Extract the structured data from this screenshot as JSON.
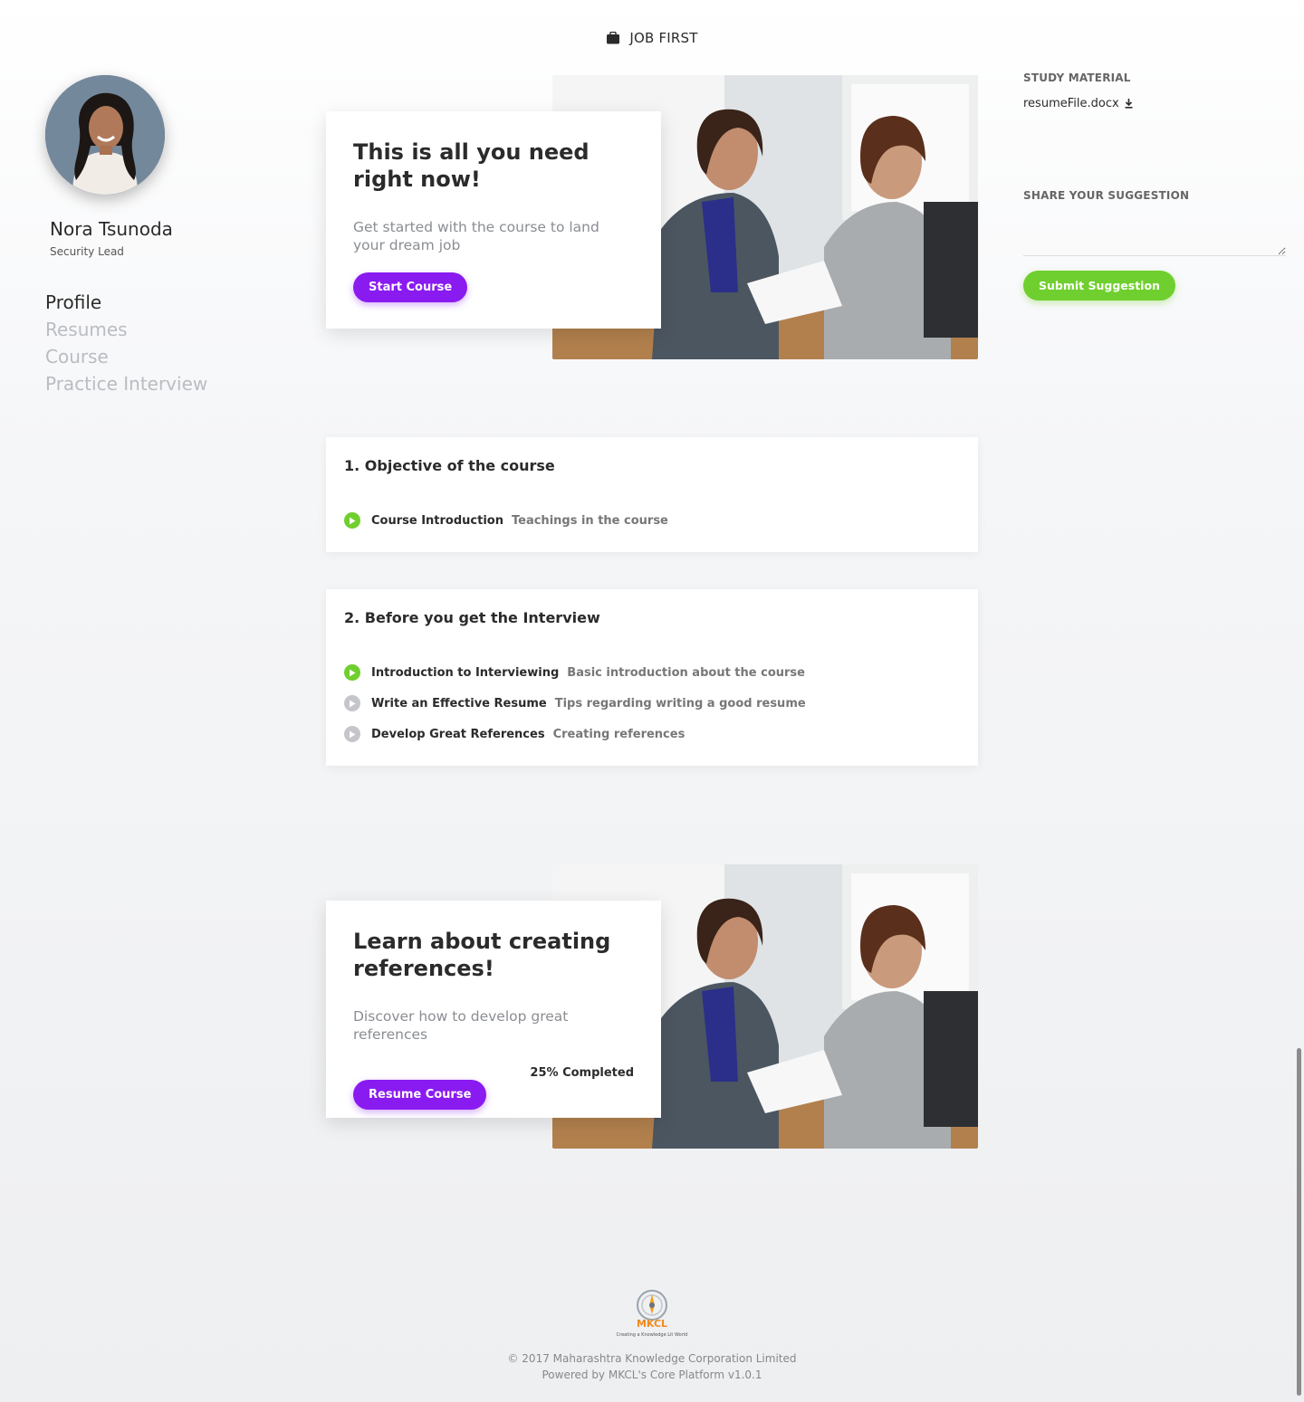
{
  "header": {
    "brand": "JOB FIRST",
    "brand_icon": "briefcase-icon"
  },
  "user": {
    "name": "Nora Tsunoda",
    "role": "Security Lead",
    "avatar_icon": "avatar"
  },
  "nav": {
    "items": [
      {
        "label": "Profile",
        "active": true
      },
      {
        "label": "Resumes",
        "active": false
      },
      {
        "label": "Course",
        "active": false
      },
      {
        "label": "Practice Interview",
        "active": false
      }
    ]
  },
  "hero": {
    "title": "This is all you need right now!",
    "subtitle": "Get started with the course to land your dream job",
    "button": "Start Course"
  },
  "study_material": {
    "label": "STUDY MATERIAL",
    "file": "resumeFile.docx",
    "file_icon": "download-icon"
  },
  "suggestion": {
    "label": "SHARE YOUR SUGGESTION",
    "value": "",
    "button": "Submit Suggestion"
  },
  "modules": [
    {
      "title": "1. Objective of the course",
      "lessons": [
        {
          "title": "Course Introduction",
          "desc": "Teachings in the course",
          "status": "active"
        }
      ]
    },
    {
      "title": "2. Before you get the Interview",
      "lessons": [
        {
          "title": "Introduction to Interviewing",
          "desc": "Basic introduction about the course",
          "status": "active"
        },
        {
          "title": "Write an Effective Resume",
          "desc": "Tips regarding writing a good resume",
          "status": "locked"
        },
        {
          "title": "Develop Great References",
          "desc": "Creating references",
          "status": "locked"
        }
      ]
    }
  ],
  "resume_card": {
    "title": "Learn about creating references!",
    "subtitle": "Discover how to develop great references",
    "button": "Resume Course",
    "progress_text": "25% Completed",
    "progress": 0.25
  },
  "footer": {
    "logo_text": "MKCL",
    "logo_tagline": "Creating a Knowledge Lit World",
    "copyright": "© 2017 Maharashtra Knowledge Corporation Limited",
    "powered": "Powered by MKCL's Core Platform v1.0.1"
  },
  "colors": {
    "accent": "#8a1bf0",
    "success": "#6fcf2e",
    "muted": "#b9bcc1"
  }
}
